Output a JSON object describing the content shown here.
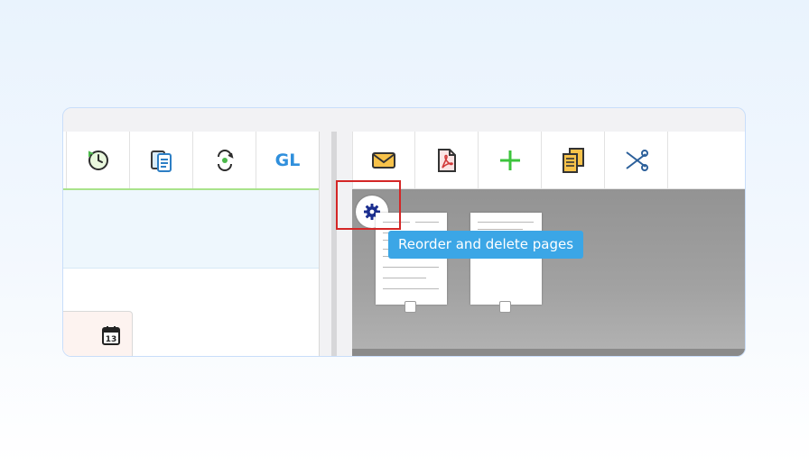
{
  "left_toolbar": {
    "buttons": [
      {
        "icon": "history-icon",
        "label": ""
      },
      {
        "icon": "documents-icon",
        "label": ""
      },
      {
        "icon": "split-view-icon",
        "label": ""
      },
      {
        "icon": "gl-icon",
        "label": "GL"
      }
    ]
  },
  "date_field": {
    "icon": "calendar-icon",
    "calendar_day": "13"
  },
  "right_toolbar": {
    "buttons": [
      {
        "icon": "envelope-icon"
      },
      {
        "icon": "pdf-icon"
      },
      {
        "icon": "plus-icon"
      },
      {
        "icon": "copy-icon"
      },
      {
        "icon": "scissors-icon"
      }
    ]
  },
  "viewer": {
    "gear_button": {
      "icon": "gear-icon"
    },
    "tooltip": "Reorder and delete pages",
    "pages": [
      {
        "page": 1
      },
      {
        "page": 2
      }
    ]
  },
  "colors": {
    "accent_green": "#a9e38b",
    "tooltip_bg": "#3ba6e6",
    "highlight_red": "#d42626",
    "gl_blue": "#2f8fdc"
  }
}
